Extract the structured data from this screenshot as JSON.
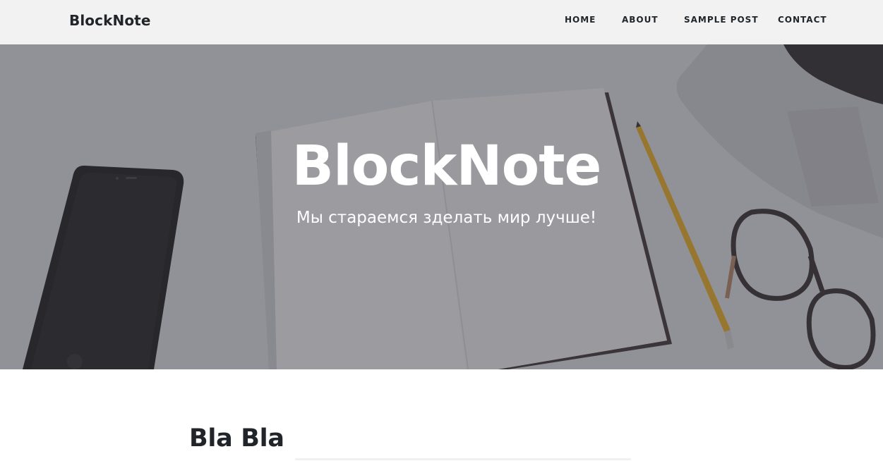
{
  "navbar": {
    "brand": "BlockNote",
    "links": [
      "HOME",
      "ABOUT",
      "SAMPLE POST",
      "CONTACT"
    ]
  },
  "hero": {
    "title": "BlockNote",
    "subtitle": "Мы стараемся зделать мир лучше!"
  },
  "post": {
    "title": "Bla Bla"
  },
  "colors": {
    "navbar_bg": "#f2f2f2",
    "text": "#212529",
    "hero_text": "#ffffff"
  }
}
